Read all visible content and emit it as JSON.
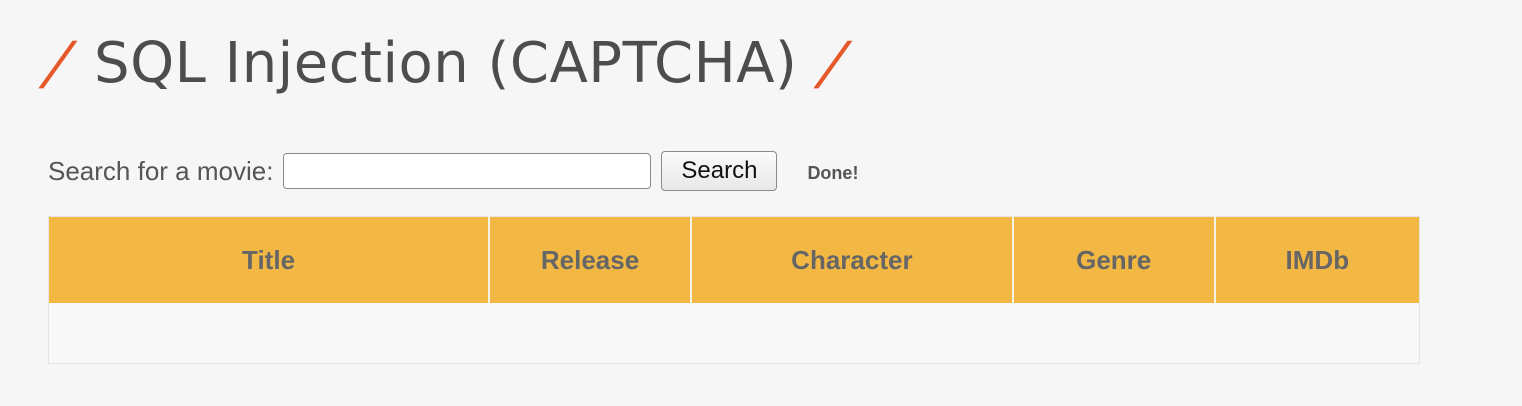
{
  "page": {
    "title": "SQL Injection (CAPTCHA)",
    "title_decoration": "/"
  },
  "search": {
    "label": "Search for a movie:",
    "input_value": "",
    "input_placeholder": "",
    "button_label": "Search",
    "status": "Done!"
  },
  "table": {
    "columns": [
      "Title",
      "Release",
      "Character",
      "Genre",
      "IMDb"
    ],
    "rows": []
  },
  "colors": {
    "accent_slash": "#e5582a",
    "table_header": "#f3b843",
    "background": "#f6f6f6"
  }
}
